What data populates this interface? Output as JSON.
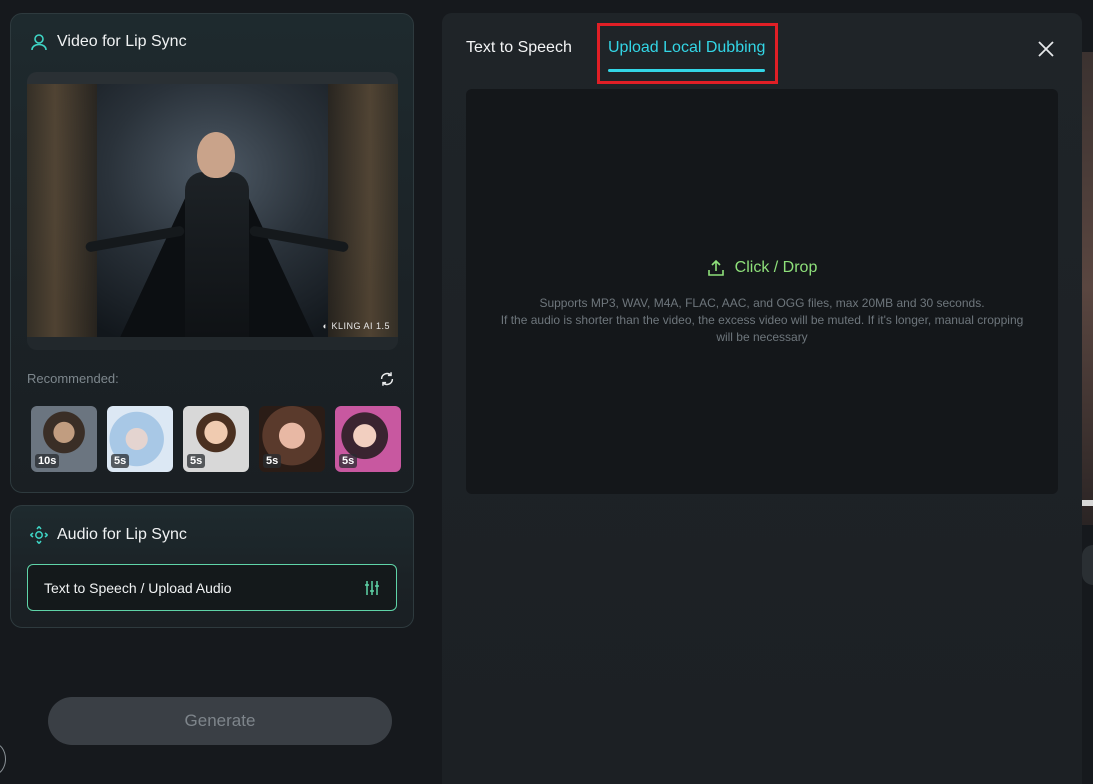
{
  "left": {
    "video_card": {
      "title": "Video for Lip Sync",
      "watermark": "KLING AI 1.5",
      "recommended_label": "Recommended:",
      "thumbnails": [
        {
          "duration": "10s"
        },
        {
          "duration": "5s"
        },
        {
          "duration": "5s"
        },
        {
          "duration": "5s"
        },
        {
          "duration": "5s"
        }
      ]
    },
    "audio_card": {
      "title": "Audio for Lip Sync",
      "field_label": "Text to Speech / Upload Audio"
    },
    "generate_label": "Generate"
  },
  "panel": {
    "tabs": [
      {
        "label": "Text to Speech",
        "active": false
      },
      {
        "label": "Upload Local Dubbing",
        "active": true
      }
    ],
    "dropzone": {
      "cta": "Click / Drop",
      "info_line1": "Supports MP3, WAV, M4A, FLAC, AAC, and OGG files, max 20MB and 30 seconds.",
      "info_line2": "If the audio is shorter than the video, the excess video will be muted. If it's longer, manual cropping will be necessary"
    }
  },
  "colors": {
    "accent_cyan": "#33d6e6",
    "accent_green": "#8ee07a",
    "highlight_red": "#e01f26",
    "border_mint": "#5fd4a8"
  }
}
